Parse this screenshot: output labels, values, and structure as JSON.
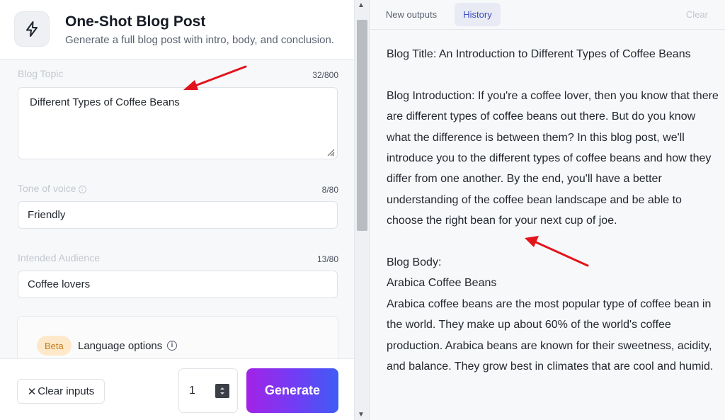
{
  "app": {
    "title": "One-Shot Blog Post",
    "subtitle": "Generate a full blog post with intro, body, and conclusion.",
    "icon": "lightning-icon"
  },
  "form": {
    "blog_topic": {
      "label": "Blog Topic",
      "counter": "32/800",
      "value": "Different Types of Coffee Beans"
    },
    "tone": {
      "label": "Tone of voice",
      "counter": "8/80",
      "value": "Friendly"
    },
    "audience": {
      "label": "Intended Audience",
      "counter": "13/80",
      "value": "Coffee lovers"
    },
    "language": {
      "badge": "Beta",
      "label": "Language options"
    }
  },
  "footer": {
    "clear_label": "Clear inputs",
    "quantity": "1",
    "generate_label": "Generate"
  },
  "tabs": [
    {
      "label": "New outputs",
      "active": false
    },
    {
      "label": "History",
      "active": true
    }
  ],
  "clear_history_label": "Clear",
  "output": {
    "title": "Blog Title: An Introduction to Different Types of Coffee Beans",
    "intro": "Blog Introduction: If you're a coffee lover, then you know that there are different types of coffee beans out there. But do you know what the difference is between them? In this blog post, we'll introduce you to the different types of coffee beans and how they differ from one another. By the end, you'll have a better understanding of the coffee bean landscape and be able to choose the right bean for your next cup of joe.",
    "body_heading": "Blog Body:",
    "section_heading": "Arabica Coffee Beans",
    "section_text": "Arabica coffee beans are the most popular type of coffee bean in the world. They make up about 60% of the world's coffee production. Arabica beans are known for their sweetness, acidity, and balance. They grow best in climates that are cool and humid."
  },
  "colors": {
    "accent": "#3b4cc0",
    "generate_start": "#a223e6",
    "generate_end": "#3f5cf5",
    "annotation_arrow": "#e3131b"
  }
}
